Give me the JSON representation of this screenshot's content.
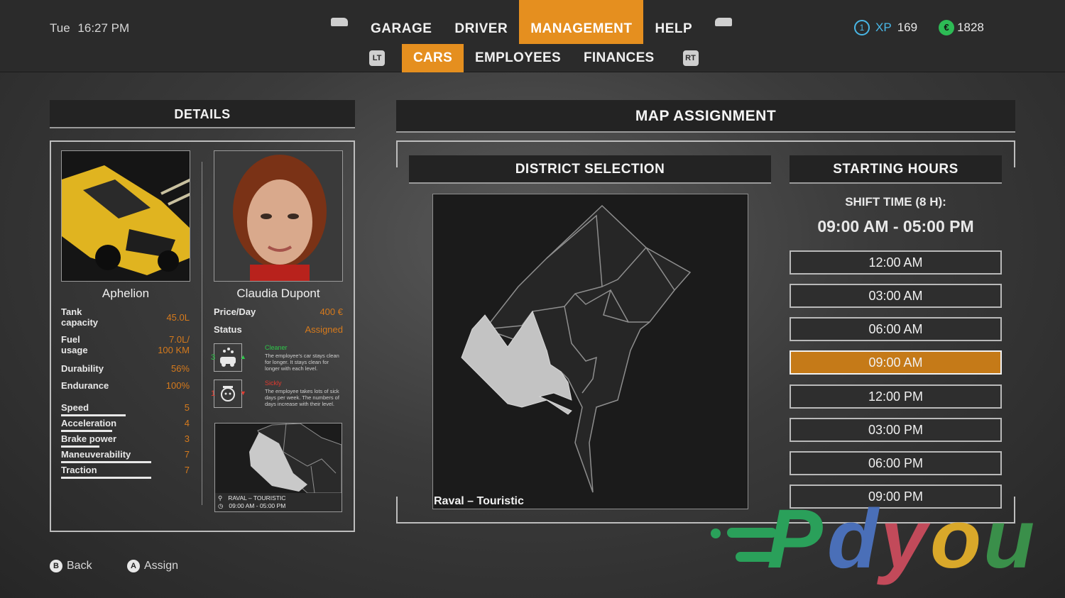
{
  "clock": {
    "day": "Tue",
    "time": "16:27 PM"
  },
  "nav": {
    "left_bumper_icon": "lb-button-icon",
    "right_bumper_icon": "rb-button-icon",
    "items": [
      "GARAGE",
      "DRIVER",
      "MANAGEMENT",
      "HELP"
    ],
    "active": "MANAGEMENT"
  },
  "subnav": {
    "left_trigger": "LT",
    "right_trigger": "RT",
    "items": [
      "CARS",
      "EMPLOYEES",
      "FINANCES"
    ],
    "active": "CARS"
  },
  "stats": {
    "level": "1",
    "xp_label": "XP",
    "xp_value": "169",
    "currency_symbol": "€",
    "money": "1828"
  },
  "details": {
    "header": "DETAILS",
    "car": {
      "name": "Aphelion",
      "specs": [
        {
          "label_line1": "Tank",
          "label_line2": "capacity",
          "value": "45.0L"
        },
        {
          "label_line1": "Fuel",
          "label_line2": "usage",
          "value_line1": "7.0L/",
          "value_line2": "100 KM"
        },
        {
          "label": "Durability",
          "value": "56%"
        },
        {
          "label": "Endurance",
          "value": "100%"
        }
      ],
      "performance": [
        {
          "label": "Speed",
          "value": "5",
          "level": 0.5
        },
        {
          "label": "Acceleration",
          "value": "4",
          "level": 0.4
        },
        {
          "label": "Brake power",
          "value": "3",
          "level": 0.3
        },
        {
          "label": "Maneuverability",
          "value": "7",
          "level": 0.7
        },
        {
          "label": "Traction",
          "value": "7",
          "level": 0.7
        }
      ]
    },
    "employee": {
      "name": "Claudia Dupont",
      "price_label": "Price/Day",
      "price_value": "400 €",
      "status_label": "Status",
      "status_value": "Assigned",
      "traits": [
        {
          "level": "3",
          "name": "Cleaner",
          "desc": "The employee's car stays clean for longer. It stays clean for longer with each level.",
          "color": "#2ec84a"
        },
        {
          "level": "1",
          "name": "Sickly",
          "desc": "The employee takes lots of sick days per week. The numbers of days increase with their level.",
          "color": "#e03a2f"
        }
      ],
      "assignment": {
        "district": "RAVAL – TOURISTIC",
        "hours": "09:00 AM - 05:00 PM"
      }
    }
  },
  "map_assignment": {
    "header": "MAP ASSIGNMENT",
    "district_header": "DISTRICT SELECTION",
    "district_name": "Raval – Touristic",
    "hours_header": "STARTING HOURS",
    "shift_label": "SHIFT TIME (8 H):",
    "shift_range": "09:00 AM - 05:00 PM",
    "slots": [
      "12:00 AM",
      "03:00 AM",
      "06:00 AM",
      "09:00 AM",
      "12:00 PM",
      "03:00 PM",
      "06:00 PM",
      "09:00 PM"
    ],
    "selected_slot": "09:00 AM"
  },
  "footer": {
    "back_key": "B",
    "back_label": "Back",
    "assign_key": "A",
    "assign_label": "Assign"
  },
  "watermark": {
    "text": "Pdyou"
  },
  "colors": {
    "accent": "#e58f1f",
    "selected_slot": "#c57a18",
    "xp": "#49b7e6",
    "money": "#2dbb55"
  }
}
